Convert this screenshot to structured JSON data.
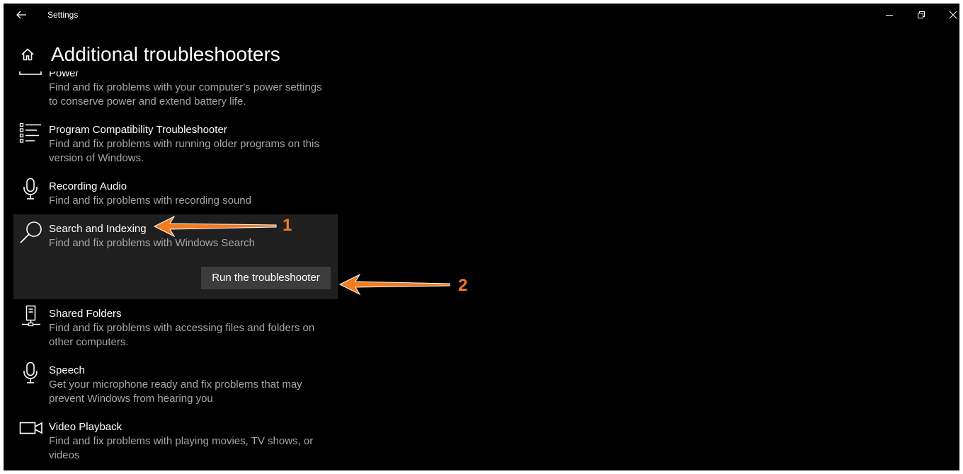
{
  "window": {
    "title": "Settings"
  },
  "page": {
    "title": "Additional troubleshooters"
  },
  "items": [
    {
      "name": "Power",
      "description": "Find and fix problems with your computer's power settings to conserve power and extend battery life.",
      "icon": "battery-icon"
    },
    {
      "name": "Program Compatibility Troubleshooter",
      "description": "Find and fix problems with running older programs on this version of Windows.",
      "icon": "list-icon"
    },
    {
      "name": "Recording Audio",
      "description": "Find and fix problems with recording sound",
      "icon": "microphone-icon"
    },
    {
      "name": "Search and Indexing",
      "description": "Find and fix problems with Windows Search",
      "icon": "search-icon",
      "selected": true,
      "action_label": "Run the troubleshooter"
    },
    {
      "name": "Shared Folders",
      "description": "Find and fix problems with accessing files and folders on other computers.",
      "icon": "shared-folders-icon"
    },
    {
      "name": "Speech",
      "description": "Get your microphone ready and fix problems that may prevent Windows from hearing you",
      "icon": "microphone-icon"
    },
    {
      "name": "Video Playback",
      "description": "Find and fix problems with playing movies, TV shows, or videos",
      "icon": "video-camera-icon"
    }
  ],
  "annotations": [
    {
      "label": "1"
    },
    {
      "label": "2"
    }
  ],
  "colors": {
    "background": "#000000",
    "selected_background": "#1f1f1f",
    "button": "#3c3c3c",
    "secondary_text": "#a6a6a6",
    "annotation": "#f07b21"
  }
}
